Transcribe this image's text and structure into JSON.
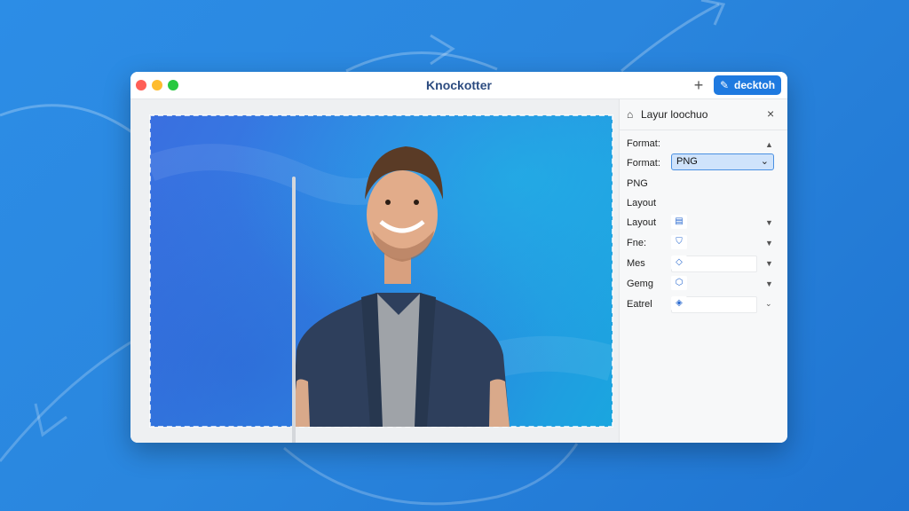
{
  "app": {
    "title": "Knockotter",
    "add_label": "+",
    "primary_button_label": "decktoh"
  },
  "panel": {
    "title": "Layur loochuo",
    "close_label": "×",
    "rows": {
      "format_heading": "Format:",
      "format_label": "Format:",
      "format_value": "PNG",
      "png_text": "PNG",
      "layout_heading": "Layout",
      "layout_label": "Layout",
      "fne_label": "Fne:",
      "mes_label": "Mes",
      "gemg_label": "Gemg",
      "eatrel_label": "Eatrel"
    }
  },
  "colors": {
    "accent": "#1f7ae0",
    "background": "#2a86de",
    "title_text": "#2d4c80"
  },
  "icons": {
    "primary_button": "magic-wand-icon",
    "panel_header": "export-icon",
    "layout": "document-icon",
    "fne": "shield-icon",
    "mes": "drop-icon",
    "gemg": "shield-icon",
    "eatrel": "tag-icon"
  }
}
